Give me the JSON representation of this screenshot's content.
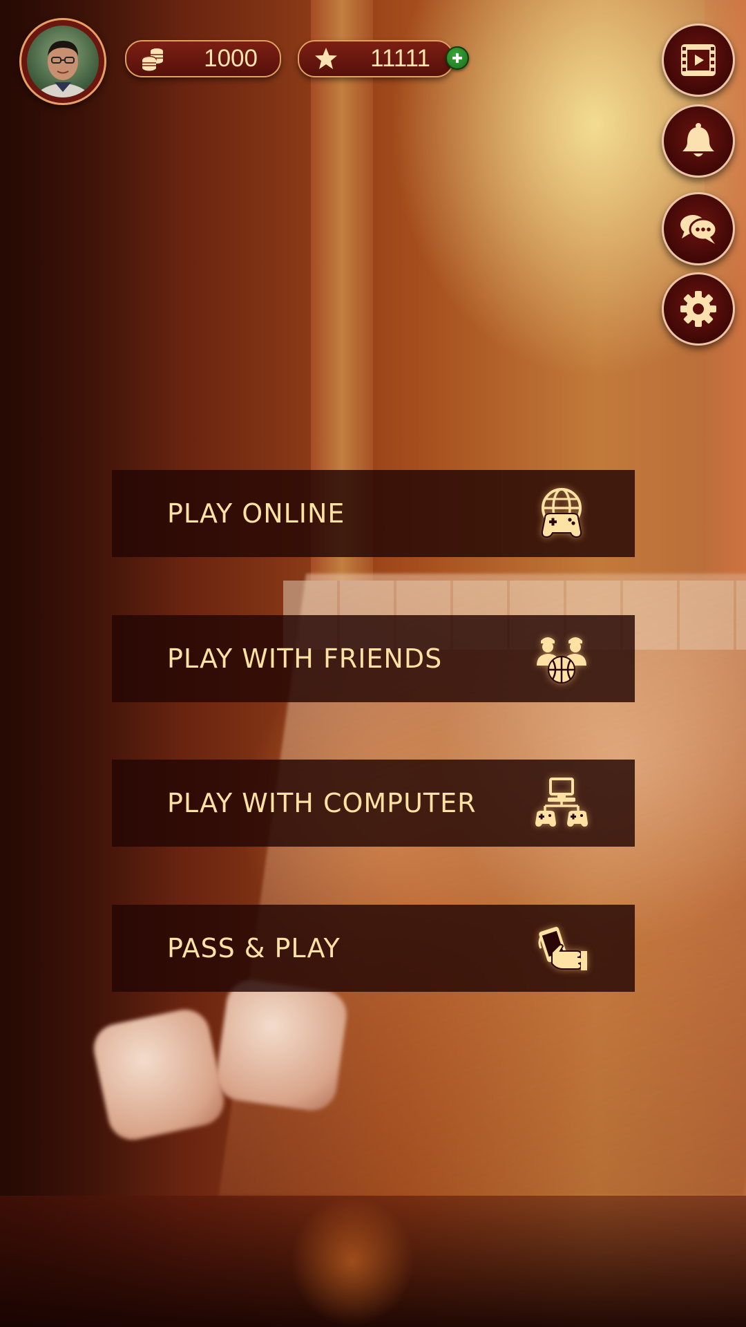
{
  "header": {
    "coins": "1000",
    "stars": "11111",
    "icons": {
      "coins": "coin-stack-icon",
      "stars": "star-icon",
      "add": "plus-icon"
    }
  },
  "side_buttons": [
    {
      "name": "video",
      "icon": "film-video-icon"
    },
    {
      "name": "notifications",
      "icon": "bell-icon"
    },
    {
      "name": "chat",
      "icon": "chat-bubbles-icon"
    },
    {
      "name": "settings",
      "icon": "gear-icon"
    }
  ],
  "menu": {
    "play_online": {
      "label": "PLAY ONLINE",
      "icon": "globe-gamepad-icon"
    },
    "play_friends": {
      "label": "PLAY WITH FRIENDS",
      "icon": "friends-ball-icon"
    },
    "play_computer": {
      "label": "PLAY WITH COMPUTER",
      "icon": "computer-network-gamepads-icon"
    },
    "pass_play": {
      "label": "PASS & PLAY",
      "icon": "phone-hand-pass-icon"
    }
  },
  "colors": {
    "label_text": "#fde2a4",
    "button_bg": "#230604",
    "pill_border": "#e2a062",
    "plus_green": "#2a8a2a"
  }
}
